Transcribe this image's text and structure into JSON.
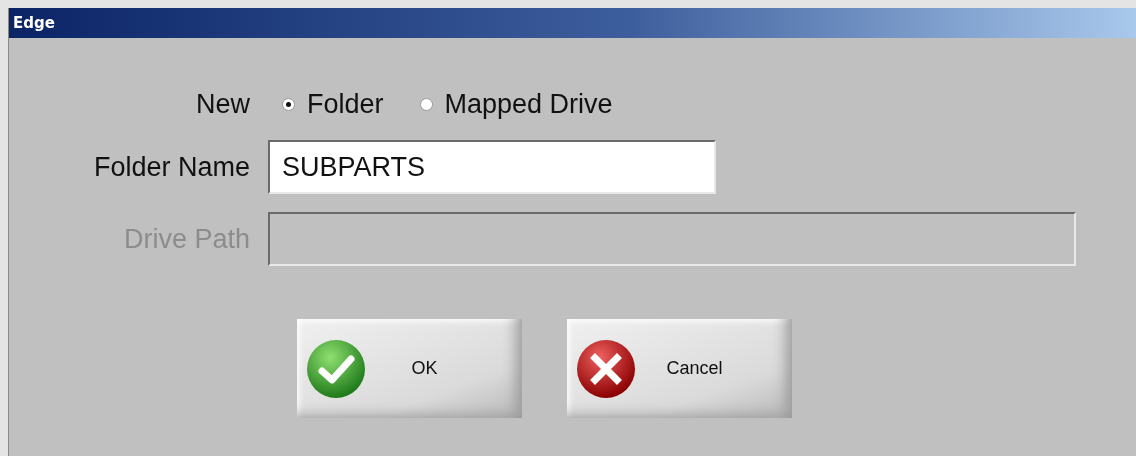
{
  "window": {
    "title": "Edge"
  },
  "new_type": {
    "label": "New",
    "options": [
      {
        "label": "Folder",
        "selected": true
      },
      {
        "label": "Mapped Drive",
        "selected": false
      }
    ]
  },
  "fields": [
    {
      "label": "Folder Name",
      "value": "SUBPARTS",
      "disabled": false
    },
    {
      "label": "Drive Path",
      "disabled": true
    }
  ],
  "buttons": [
    {
      "label": "OK",
      "kind": "ok"
    },
    {
      "label": "Cancel",
      "kind": "cancel"
    }
  ]
}
